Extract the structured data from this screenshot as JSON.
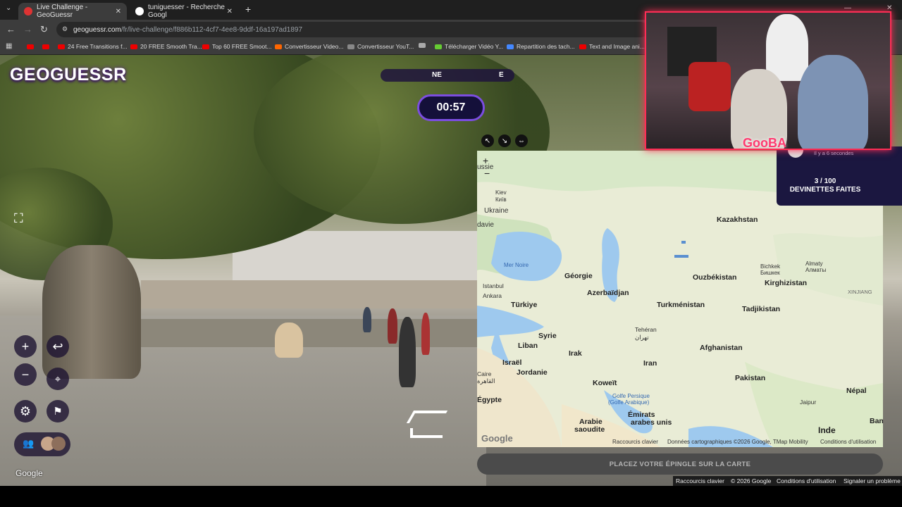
{
  "browser": {
    "tabs": [
      {
        "title": "Live Challenge - GeoGuessr",
        "active": true
      },
      {
        "title": "tuniguesser - Recherche Googl",
        "active": false
      }
    ],
    "new_tab": "+",
    "url_host": "geoguessr.com",
    "url_path": "/fr/live-challenge/f886b112-4cf7-4ee8-9ddf-16a197ad1897",
    "bookmarks": [
      "24 Free Transitions f...",
      "20 FREE Smooth Tra...",
      "Top 60 FREE Smoot...",
      "Convertisseur Video...",
      "Convertisseur YouT...",
      "Télécharger Vidéo Y...",
      "Repartition des tach...",
      "Text and Image ani..."
    ]
  },
  "game": {
    "logo": "GEOGUESSR",
    "compass": {
      "ne": "NE",
      "e": "E"
    },
    "timer": "00:57",
    "google_watermark": "Google",
    "status_panel": {
      "ago": "Il y a 6 secondes",
      "count": "3 / 100",
      "label": "DEVINETTES FAITES"
    },
    "pin_button": "PLACEZ VOTRE ÉPINGLE SUR LA CARTE",
    "cam_tag": "GooBA"
  },
  "map": {
    "zoom_in": "+",
    "zoom_out": "−",
    "labels": [
      "ussie",
      "Kiev",
      "Київ",
      "Ukraine",
      "davie",
      "Kazakhstan",
      "Mer Noire",
      "Bichkek",
      "Бишкек",
      "Almaty",
      "Алматы",
      "Géorgie",
      "Ouzbékistan",
      "Kirghizistan",
      "Istanbul",
      "Ankara",
      "Azerbaïdjan",
      "XINJIANG",
      "Türkiye",
      "Turkménistan",
      "Tadjikistan",
      "Tehéran",
      "تهران",
      "Syrie",
      "Afghanistan",
      "Liban",
      "Irak",
      "Israël",
      "Iran",
      "Jordanie",
      "Pakistan",
      "Caire",
      "القاهرة",
      "Koweït",
      "Népal",
      "Golfe Persique",
      "(Golfe Arabique)",
      "Égypte",
      "Émirats",
      "arabes unis",
      "Jaipur",
      "Arabie",
      "saoudite",
      "Inde",
      "Ban"
    ],
    "footer": {
      "shortcuts": "Raccourcis clavier",
      "data": "Données cartographiques ©2026 Google, TMap Mobility",
      "terms": "Conditions d'utilisation"
    },
    "google_logo": "Google"
  },
  "page_footer": {
    "shortcuts": "Raccourcis clavier",
    "copyright": "© 2026 Google",
    "terms": "Conditions d'utilisation",
    "report": "Signaler un problème"
  },
  "colors": {
    "accent": "#7b4de0",
    "panel": "#1b1740",
    "cam_border": "#ff2d55"
  }
}
